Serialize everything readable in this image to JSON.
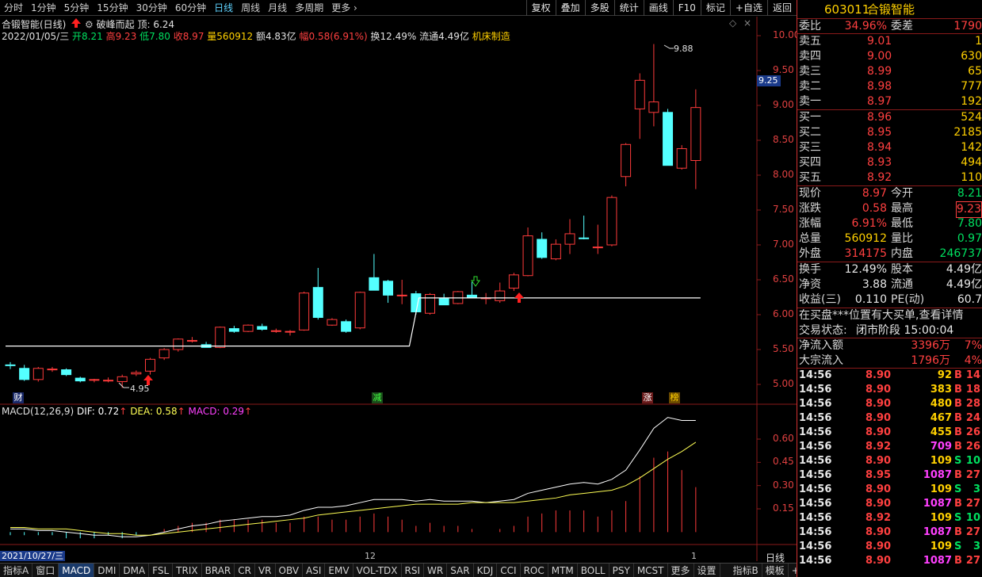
{
  "toolbar": {
    "periods": [
      "分时",
      "1分钟",
      "5分钟",
      "15分钟",
      "30分钟",
      "60分钟",
      "日线",
      "周线",
      "月线",
      "多周期",
      "更多"
    ],
    "active_period": "日线",
    "right_tools": [
      "复权",
      "叠加",
      "多股",
      "统计",
      "画线",
      "F10",
      "标记",
      "+自选",
      "返回"
    ]
  },
  "chart_header": {
    "title": "合锻智能(日线)",
    "indicator_name": "破峰而起",
    "indicator_value": "顶: 6.24",
    "date": "2022/01/05/三",
    "open": "开8.21",
    "high": "高9.23",
    "low": "低7.80",
    "close": "收8.97",
    "volume": "量560912",
    "amount": "额4.83亿",
    "change": "幅0.58(6.91%)",
    "turnover": "换12.49%",
    "float": "流通4.49亿",
    "industry": "机床制造"
  },
  "macd_header": {
    "name": "MACD(12,26,9)",
    "dif": "DIF: 0.72",
    "dea": "DEA: 0.58",
    "macd": "MACD: 0.29"
  },
  "price_axis": [
    "10.00",
    "9.50",
    "9.00",
    "8.50",
    "8.00",
    "7.50",
    "7.00",
    "6.50",
    "6.00",
    "5.50",
    "5.00"
  ],
  "current_price_tag": "9.25",
  "macd_axis": [
    "0.60",
    "0.45",
    "0.30",
    "0.15"
  ],
  "annotations": {
    "high_mark": "9.88",
    "low_mark": "4.95",
    "badge_cai": "财",
    "badge_jian": "减",
    "badge_zhang": "涨",
    "badge_bang": "榜"
  },
  "x_axis": {
    "start_date": "2021/10/27/三",
    "month_12": "12",
    "month_1": "1",
    "period_label": "日线"
  },
  "bottom_tabs": [
    "指标A",
    "窗口",
    "MACD",
    "DMI",
    "DMA",
    "FSL",
    "TRIX",
    "BRAR",
    "CR",
    "VR",
    "OBV",
    "ASI",
    "EMV",
    "VOL-TDX",
    "RSI",
    "WR",
    "SAR",
    "KDJ",
    "CCI",
    "ROC",
    "MTM",
    "BOLL",
    "PSY",
    "MCST",
    "更多",
    "设置"
  ],
  "bottom_right_tabs": [
    "指标B",
    "模板",
    "+",
    "-"
  ],
  "chart_data": {
    "type": "candlestick",
    "ylim": [
      4.7,
      10.2
    ],
    "candles": [
      {
        "o": 5.28,
        "h": 5.32,
        "l": 5.22,
        "c": 5.27
      },
      {
        "o": 5.23,
        "h": 5.28,
        "l": 5.05,
        "c": 5.07
      },
      {
        "o": 5.07,
        "h": 5.25,
        "l": 5.04,
        "c": 5.23
      },
      {
        "o": 5.21,
        "h": 5.25,
        "l": 5.18,
        "c": 5.22
      },
      {
        "o": 5.21,
        "h": 5.23,
        "l": 5.12,
        "c": 5.14
      },
      {
        "o": 5.09,
        "h": 5.11,
        "l": 5.03,
        "c": 5.05
      },
      {
        "o": 5.06,
        "h": 5.08,
        "l": 5.03,
        "c": 5.07
      },
      {
        "o": 5.06,
        "h": 5.1,
        "l": 5.03,
        "c": 5.06
      },
      {
        "o": 5.04,
        "h": 5.14,
        "l": 4.95,
        "c": 5.11
      },
      {
        "o": 5.15,
        "h": 5.2,
        "l": 5.12,
        "c": 5.17
      },
      {
        "o": 5.19,
        "h": 5.38,
        "l": 5.14,
        "c": 5.36
      },
      {
        "o": 5.38,
        "h": 5.52,
        "l": 5.35,
        "c": 5.5
      },
      {
        "o": 5.5,
        "h": 5.66,
        "l": 5.47,
        "c": 5.65
      },
      {
        "o": 5.63,
        "h": 5.68,
        "l": 5.6,
        "c": 5.63
      },
      {
        "o": 5.57,
        "h": 5.61,
        "l": 5.53,
        "c": 5.53
      },
      {
        "o": 5.53,
        "h": 5.83,
        "l": 5.52,
        "c": 5.82
      },
      {
        "o": 5.8,
        "h": 5.84,
        "l": 5.74,
        "c": 5.76
      },
      {
        "o": 5.76,
        "h": 5.86,
        "l": 5.75,
        "c": 5.85
      },
      {
        "o": 5.83,
        "h": 5.87,
        "l": 5.77,
        "c": 5.79
      },
      {
        "o": 5.77,
        "h": 5.8,
        "l": 5.74,
        "c": 5.77
      },
      {
        "o": 5.76,
        "h": 5.78,
        "l": 5.7,
        "c": 5.76
      },
      {
        "o": 5.78,
        "h": 6.33,
        "l": 5.77,
        "c": 6.31
      },
      {
        "o": 6.39,
        "h": 6.67,
        "l": 5.93,
        "c": 5.96
      },
      {
        "o": 5.85,
        "h": 5.95,
        "l": 5.84,
        "c": 5.93
      },
      {
        "o": 5.9,
        "h": 5.93,
        "l": 5.74,
        "c": 5.76
      },
      {
        "o": 5.81,
        "h": 6.33,
        "l": 5.79,
        "c": 6.32
      },
      {
        "o": 6.53,
        "h": 6.87,
        "l": 6.35,
        "c": 6.35
      },
      {
        "o": 6.48,
        "h": 6.5,
        "l": 6.17,
        "c": 6.28
      },
      {
        "o": 6.27,
        "h": 6.5,
        "l": 6.15,
        "c": 6.28
      },
      {
        "o": 6.3,
        "h": 6.34,
        "l": 6.0,
        "c": 6.04
      },
      {
        "o": 6.02,
        "h": 6.31,
        "l": 6.0,
        "c": 6.29
      },
      {
        "o": 6.23,
        "h": 6.3,
        "l": 6.14,
        "c": 6.14
      },
      {
        "o": 6.16,
        "h": 6.34,
        "l": 6.15,
        "c": 6.33
      },
      {
        "o": 6.28,
        "h": 6.47,
        "l": 6.24,
        "c": 6.25
      },
      {
        "o": 6.24,
        "h": 6.31,
        "l": 6.15,
        "c": 6.24
      },
      {
        "o": 6.2,
        "h": 6.46,
        "l": 6.17,
        "c": 6.34
      },
      {
        "o": 6.38,
        "h": 6.6,
        "l": 6.34,
        "c": 6.57
      },
      {
        "o": 6.56,
        "h": 7.25,
        "l": 6.55,
        "c": 7.13
      },
      {
        "o": 7.08,
        "h": 7.18,
        "l": 6.8,
        "c": 6.82
      },
      {
        "o": 6.8,
        "h": 7.08,
        "l": 6.78,
        "c": 7.01
      },
      {
        "o": 7.01,
        "h": 7.37,
        "l": 6.87,
        "c": 7.16
      },
      {
        "o": 7.1,
        "h": 7.42,
        "l": 7.08,
        "c": 7.09
      },
      {
        "o": 6.96,
        "h": 7.29,
        "l": 6.87,
        "c": 6.97
      },
      {
        "o": 7.0,
        "h": 7.71,
        "l": 6.98,
        "c": 7.68
      },
      {
        "o": 7.98,
        "h": 8.46,
        "l": 7.84,
        "c": 8.44
      },
      {
        "o": 8.95,
        "h": 9.46,
        "l": 8.52,
        "c": 9.36
      },
      {
        "o": 8.9,
        "h": 9.88,
        "l": 8.7,
        "c": 9.05
      },
      {
        "o": 8.9,
        "h": 8.95,
        "l": 8.14,
        "c": 8.14
      },
      {
        "o": 8.1,
        "h": 8.43,
        "l": 8.08,
        "c": 8.38
      },
      {
        "o": 8.21,
        "h": 9.23,
        "l": 7.8,
        "c": 8.97
      }
    ],
    "peak_breakout_line": {
      "before": 5.55,
      "after": 6.24,
      "switch_index": 30
    },
    "macd": {
      "dif": [
        0.02,
        0.02,
        0.01,
        0.01,
        0.0,
        -0.01,
        -0.02,
        -0.02,
        -0.03,
        -0.03,
        -0.02,
        0.0,
        0.02,
        0.04,
        0.05,
        0.07,
        0.08,
        0.09,
        0.1,
        0.1,
        0.11,
        0.14,
        0.16,
        0.16,
        0.17,
        0.19,
        0.21,
        0.21,
        0.21,
        0.2,
        0.21,
        0.2,
        0.2,
        0.2,
        0.19,
        0.2,
        0.21,
        0.25,
        0.27,
        0.29,
        0.31,
        0.32,
        0.31,
        0.34,
        0.4,
        0.53,
        0.67,
        0.74,
        0.72,
        0.72
      ],
      "dea": [
        0.03,
        0.03,
        0.02,
        0.02,
        0.02,
        0.01,
        0.0,
        -0.01,
        -0.01,
        -0.02,
        -0.02,
        -0.01,
        0.0,
        0.01,
        0.02,
        0.03,
        0.04,
        0.05,
        0.06,
        0.07,
        0.08,
        0.09,
        0.11,
        0.12,
        0.13,
        0.14,
        0.15,
        0.16,
        0.17,
        0.18,
        0.18,
        0.18,
        0.18,
        0.19,
        0.19,
        0.19,
        0.19,
        0.2,
        0.21,
        0.22,
        0.24,
        0.25,
        0.26,
        0.27,
        0.3,
        0.35,
        0.41,
        0.47,
        0.52,
        0.58
      ],
      "hist": [
        -0.02,
        -0.02,
        -0.02,
        -0.02,
        -0.04,
        -0.04,
        -0.04,
        -0.02,
        -0.04,
        -0.02,
        0.0,
        0.02,
        0.04,
        0.06,
        0.06,
        0.08,
        0.08,
        0.08,
        0.08,
        0.06,
        0.06,
        0.1,
        0.1,
        0.08,
        0.08,
        0.1,
        0.12,
        0.1,
        0.08,
        0.04,
        0.06,
        0.04,
        0.04,
        0.02,
        0.0,
        0.02,
        0.04,
        0.1,
        0.12,
        0.14,
        0.14,
        0.14,
        0.1,
        0.14,
        0.2,
        0.36,
        0.48,
        0.52,
        0.4,
        0.29
      ]
    },
    "macd_ylim": [
      -0.06,
      0.8
    ]
  },
  "panel": {
    "stock_code": "603011",
    "stock_name": "合锻智能",
    "order_ratio_label": "委比",
    "order_ratio": "34.96%",
    "order_diff_label": "委差",
    "order_diff": "1790",
    "asks": [
      {
        "label": "卖五",
        "price": "9.01",
        "vol": "1"
      },
      {
        "label": "卖四",
        "price": "9.00",
        "vol": "630"
      },
      {
        "label": "卖三",
        "price": "8.99",
        "vol": "65"
      },
      {
        "label": "卖二",
        "price": "8.98",
        "vol": "777"
      },
      {
        "label": "卖一",
        "price": "8.97",
        "vol": "192"
      }
    ],
    "bids": [
      {
        "label": "买一",
        "price": "8.96",
        "vol": "524"
      },
      {
        "label": "买二",
        "price": "8.95",
        "vol": "2185"
      },
      {
        "label": "买三",
        "price": "8.94",
        "vol": "142"
      },
      {
        "label": "买四",
        "price": "8.93",
        "vol": "494"
      },
      {
        "label": "买五",
        "price": "8.92",
        "vol": "110"
      }
    ],
    "stats": [
      {
        "l1": "现价",
        "v1": "8.97",
        "c1": "red",
        "l2": "今开",
        "v2": "8.21",
        "c2": "green"
      },
      {
        "l1": "涨跌",
        "v1": "0.58",
        "c1": "red",
        "l2": "最高",
        "v2": "9.23",
        "c2": "red"
      },
      {
        "l1": "涨幅",
        "v1": "6.91%",
        "c1": "red",
        "l2": "最低",
        "v2": "7.80",
        "c2": "green"
      },
      {
        "l1": "总量",
        "v1": "560912",
        "c1": "yellow",
        "l2": "量比",
        "v2": "0.97",
        "c2": "green"
      },
      {
        "l1": "外盘",
        "v1": "314175",
        "c1": "red",
        "l2": "内盘",
        "v2": "246737",
        "c2": "green"
      }
    ],
    "stats2": [
      {
        "l1": "换手",
        "v1": "12.49%",
        "l2": "股本",
        "v2": "4.49亿"
      },
      {
        "l1": "净资",
        "v1": "3.88",
        "l2": "流通",
        "v2": "4.49亿"
      },
      {
        "l1": "收益(三)",
        "v1": "0.110",
        "l2": "PE(动)",
        "v2": "60.7"
      }
    ],
    "notice": "在买盘***位置有大买单,查看详情",
    "trade_status_label": "交易状态:",
    "trade_status": "闭市阶段 15:00:04",
    "net_inflow_label": "净流入额",
    "net_inflow": "3396万",
    "net_inflow_pct": "7%",
    "big_inflow_label": "大宗流入",
    "big_inflow": "1796万",
    "big_inflow_pct": "4%",
    "ticks": [
      {
        "t": "14:56",
        "p": "8.90",
        "v": "92",
        "s": "B",
        "n": "14"
      },
      {
        "t": "14:56",
        "p": "8.90",
        "v": "383",
        "s": "B",
        "n": "18"
      },
      {
        "t": "14:56",
        "p": "8.90",
        "v": "480",
        "s": "B",
        "n": "28"
      },
      {
        "t": "14:56",
        "p": "8.90",
        "v": "467",
        "s": "B",
        "n": "24"
      },
      {
        "t": "14:56",
        "p": "8.90",
        "v": "455",
        "s": "B",
        "n": "26"
      },
      {
        "t": "14:56",
        "p": "8.92",
        "v": "709",
        "s": "B",
        "n": "26"
      },
      {
        "t": "14:56",
        "p": "8.90",
        "v": "109",
        "s": "S",
        "n": "10"
      },
      {
        "t": "14:56",
        "p": "8.95",
        "v": "1087",
        "s": "B",
        "n": "27"
      },
      {
        "t": "14:56",
        "p": "8.90",
        "v": "109",
        "s": "S",
        "n": "3"
      },
      {
        "t": "14:56",
        "p": "8.90",
        "v": "1087",
        "s": "B",
        "n": "27"
      },
      {
        "t": "14:56",
        "p": "8.92",
        "v": "109",
        "s": "S",
        "n": "10"
      },
      {
        "t": "14:56",
        "p": "8.90",
        "v": "1087",
        "s": "B",
        "n": "27"
      },
      {
        "t": "14:56",
        "p": "8.90",
        "v": "109",
        "s": "S",
        "n": "3"
      },
      {
        "t": "14:56",
        "p": "8.90",
        "v": "1087",
        "s": "B",
        "n": "27"
      }
    ]
  },
  "colors": {
    "up": "#ff3b3b",
    "down": "#54ffff",
    "dif": "#ffffff",
    "dea": "#ffff55",
    "grid": "#8a1a1a"
  }
}
